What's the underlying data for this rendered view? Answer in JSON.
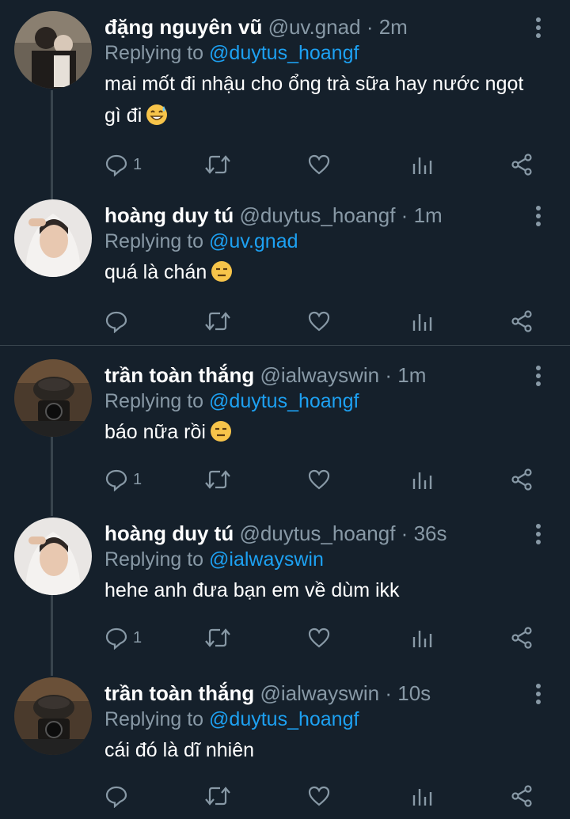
{
  "tweets": [
    {
      "name": "đặng nguyên vũ",
      "handle": "@uv.gnad",
      "time": "2m",
      "reply_prefix": "Replying to",
      "reply_to": "@duytus_hoangf",
      "text_line1": "mai mốt đi nhậu cho ổng trà sữa hay nước ngọt",
      "text_line2": "gì đi",
      "emoji": "grinning-sweat-emoji",
      "reply_count": "1",
      "avatar": "user-photo-couple"
    },
    {
      "name": "hoàng duy tú",
      "handle": "@duytus_hoangf",
      "time": "1m",
      "reply_prefix": "Replying to",
      "reply_to": "@uv.gnad",
      "text_line1": "quá là chán",
      "emoji": "expressionless-emoji",
      "reply_count": "",
      "avatar": "user-photo-hoodie"
    },
    {
      "name": "trần toàn thắng",
      "handle": "@ialwayswin",
      "time": "1m",
      "reply_prefix": "Replying to",
      "reply_to": "@duytus_hoangf",
      "text_line1": "báo nữa rồi",
      "emoji": "expressionless-emoji",
      "reply_count": "1",
      "avatar": "user-photo-camera"
    },
    {
      "name": "hoàng duy tú",
      "handle": "@duytus_hoangf",
      "time": "36s",
      "reply_prefix": "Replying to",
      "reply_to": "@ialwayswin",
      "text_line1": "hehe anh đưa bạn em về dùm ikk",
      "reply_count": "1",
      "avatar": "user-photo-hoodie"
    },
    {
      "name": "trần toàn thắng",
      "handle": "@ialwayswin",
      "time": "10s",
      "reply_prefix": "Replying to",
      "reply_to": "@duytus_hoangf",
      "text_line1": "cái đó là dĩ nhiên",
      "reply_count": "",
      "avatar": "user-photo-camera"
    }
  ],
  "separator": "·",
  "colors": {
    "background": "#15202b",
    "secondary_text": "#8899a6",
    "mention": "#1da1f2",
    "thread_line": "#38444d"
  }
}
